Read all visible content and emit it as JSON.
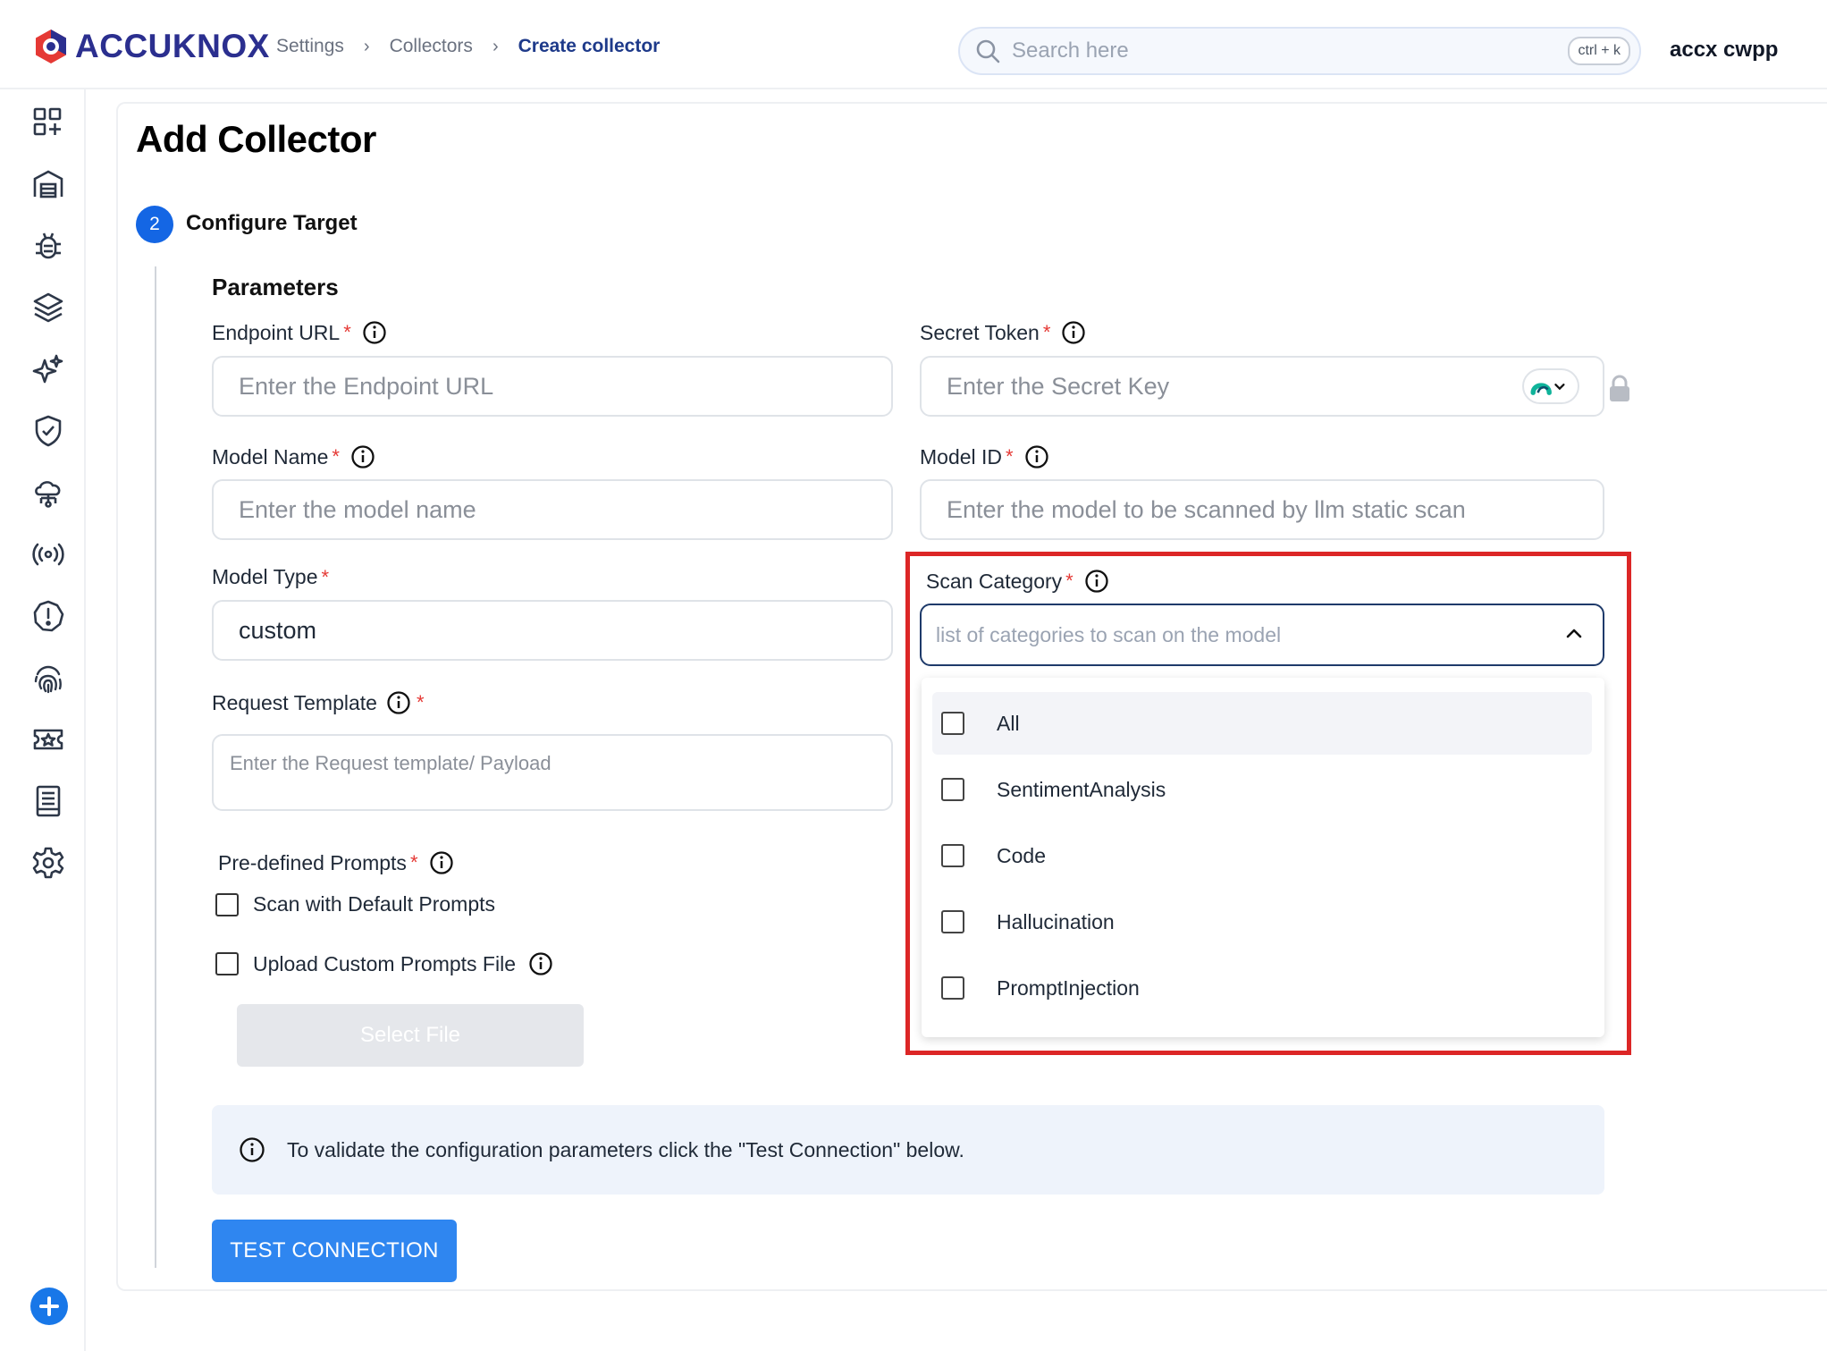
{
  "header": {
    "logo_text": "ACCUKNOX",
    "breadcrumb": [
      "Settings",
      "Collectors",
      "Create collector"
    ],
    "search_placeholder": "Search here",
    "search_shortcut": "ctrl + k",
    "user_name": "accx cwpp"
  },
  "sidebar": {
    "icons": [
      "dashboard-icon",
      "inventory-icon",
      "bug-icon",
      "layers-icon",
      "sparkles-icon",
      "shield-check-icon",
      "cloud-network-icon",
      "broadcast-icon",
      "alert-icon",
      "fingerprint-icon",
      "ticket-icon",
      "report-icon",
      "settings-icon"
    ],
    "add_icon": "plus-circle-icon"
  },
  "page": {
    "title": "Add Collector",
    "step_number": "2",
    "step_label": "Configure Target",
    "section_title": "Parameters"
  },
  "form": {
    "endpoint_url": {
      "label": "Endpoint URL",
      "placeholder": "Enter the Endpoint URL"
    },
    "secret_token": {
      "label": "Secret Token",
      "placeholder": "Enter the Secret Key"
    },
    "model_name": {
      "label": "Model Name",
      "placeholder": "Enter the model name"
    },
    "model_id": {
      "label": "Model ID",
      "placeholder": "Enter the model to be scanned by llm static scan"
    },
    "model_type": {
      "label": "Model Type",
      "value": "custom"
    },
    "request_template": {
      "label": "Request Template",
      "placeholder": "Enter the Request template/ Payload"
    },
    "scan_category": {
      "label": "Scan Category",
      "placeholder": "list of categories to scan on the model",
      "options": [
        "All",
        "SentimentAnalysis",
        "Code",
        "Hallucination",
        "PromptInjection"
      ]
    },
    "predefined_prompts": {
      "label": "Pre-defined Prompts",
      "default_prompts_label": "Scan with Default Prompts",
      "custom_prompts_label": "Upload Custom Prompts File",
      "select_file_label": "Select File"
    },
    "required_mark": "*"
  },
  "alert": {
    "text": "To validate the configuration parameters click the \"Test Connection\" below."
  },
  "actions": {
    "test_connection_label": "TEST CONNECTION"
  },
  "colors": {
    "primary": "#1466e4",
    "button": "#2f86f0",
    "highlight": "#dc2626",
    "required": "#e53935"
  }
}
